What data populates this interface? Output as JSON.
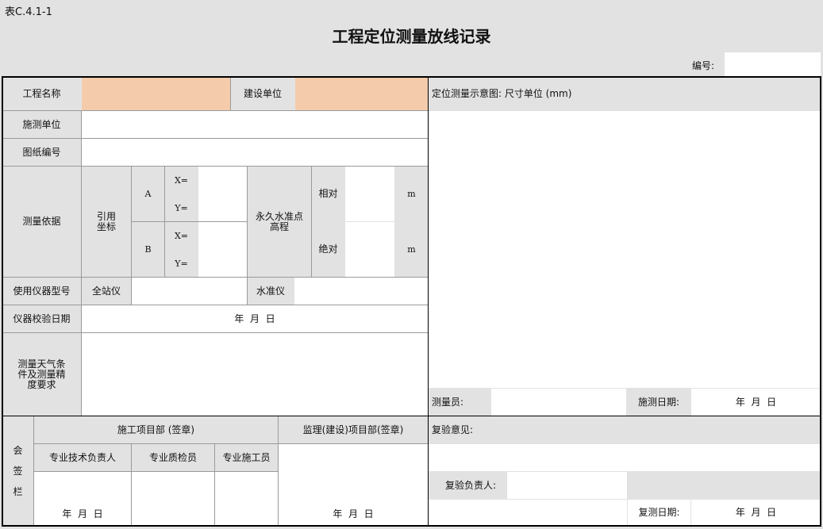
{
  "form_code": "表C.4.1-1",
  "title": "工程定位测量放线记录",
  "number_label": "编号:",
  "labels": {
    "project_name": "工程名称",
    "construction_unit": "建设单位",
    "survey_unit": "施测单位",
    "drawing_no": "图纸编号",
    "survey_basis": "测量依据",
    "ref_coords": "引用坐标",
    "point_a": "A",
    "point_b": "B",
    "x": "X=",
    "y": "Y=",
    "benchmark": "永久水准点高程",
    "relative": "相对",
    "absolute": "绝对",
    "unit_m": "m",
    "instrument_model": "使用仪器型号",
    "total_station": "全站仪",
    "level": "水准仪",
    "calibration_date": "仪器校验日期",
    "date_ymd": "年  月  日",
    "weather": "测量天气条件及测量精度要求",
    "schematic": "定位测量示意图: 尺寸单位 (mm)",
    "surveyor": "测量员:",
    "survey_date": "施测日期:",
    "sign_section": "会签栏",
    "contractor_dept": "施工项目部 (签章)",
    "supervisor_dept": "监理(建设)项目部(签章)",
    "tech_lead": "专业技术负责人",
    "quality_inspector": "专业质检员",
    "construction_worker": "专业施工员",
    "review_opinion": "复验意见:",
    "reviewer": "复验负责人:",
    "review_date": "复测日期:"
  }
}
